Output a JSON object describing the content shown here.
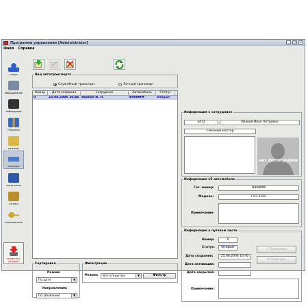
{
  "window": {
    "title": "Программа управления [Administrator]"
  },
  "window_buttons": [
    "_",
    "□",
    "x"
  ],
  "menu": [
    "Файл",
    "Справка"
  ],
  "sidebar": [
    {
      "label": "статус",
      "icon": "person-icon",
      "color": "#2c5fc8"
    },
    {
      "label": "оборудование",
      "icon": "equipment-icon",
      "color": "#7a8aa0"
    },
    {
      "label": "наблюдение",
      "icon": "camera-icon",
      "color": "#333333"
    },
    {
      "label": "персонал",
      "icon": "staff-icon",
      "color": "#3a6ab8"
    },
    {
      "label": "режимы",
      "icon": "folder-icon",
      "color": "#d8b848"
    },
    {
      "label": "автопарк",
      "icon": "car-icon",
      "color": "#4a7ad0"
    },
    {
      "label": "посетители",
      "icon": "visitors-icon",
      "color": "#3058a8"
    },
    {
      "label": "отчеты",
      "icon": "reports-icon",
      "color": "#b89030"
    },
    {
      "label": "пользователи",
      "icon": "users-keys-icon",
      "color": "#c8a830"
    }
  ],
  "apply_modes": "применить режимы",
  "transport": {
    "legend": "Вид автотранспорта",
    "option1": "Служебный транспорт",
    "option2": "Личный транспорт"
  },
  "table": {
    "headers": [
      "Номер",
      "Дата создания",
      "Сотрудник",
      "Автомобиль",
      "Статус"
    ],
    "rows": [
      [
        "0",
        "25.08.2006 16:46",
        "Иванов И. П.",
        "В908ММ",
        "Открыт"
      ]
    ]
  },
  "sort": {
    "legend": "Сортировка",
    "mode_label": "Режим:",
    "mode_value": "По дате",
    "dir_label": "Направление:",
    "dir_value": "По убыванию"
  },
  "filter": {
    "legend": "Фильтрация",
    "mode_label": "Режим:",
    "mode_value": "Все открытые",
    "button": "Фильтр"
  },
  "employee": {
    "legend": "Информация о сотруднике",
    "id": "3472",
    "name": "Иванов Иван Петрович",
    "position": "Сменный мастер",
    "photo_text": "нет фотографии"
  },
  "car": {
    "legend": "Информация об автомобиле",
    "gos_label": "Гос. номер:",
    "gos_value": "В908ММ",
    "model_label": "Модель:",
    "model_value": "ГАЗ-3102",
    "note_label": "Примечание:"
  },
  "waybill": {
    "legend": "Информация о путевом листе",
    "number_label": "Номер:",
    "number_value": "0",
    "status_label": "Статус:",
    "status_value": "Открыт",
    "created_label": "Дата создания:",
    "created_value": "25.08.2006 16:46",
    "activated_label": "Дата активации:",
    "closed_label": "Дата закрытия:",
    "note_label": "Примечание:",
    "apply_button": "Применить",
    "cancel_button": "Отменить"
  }
}
